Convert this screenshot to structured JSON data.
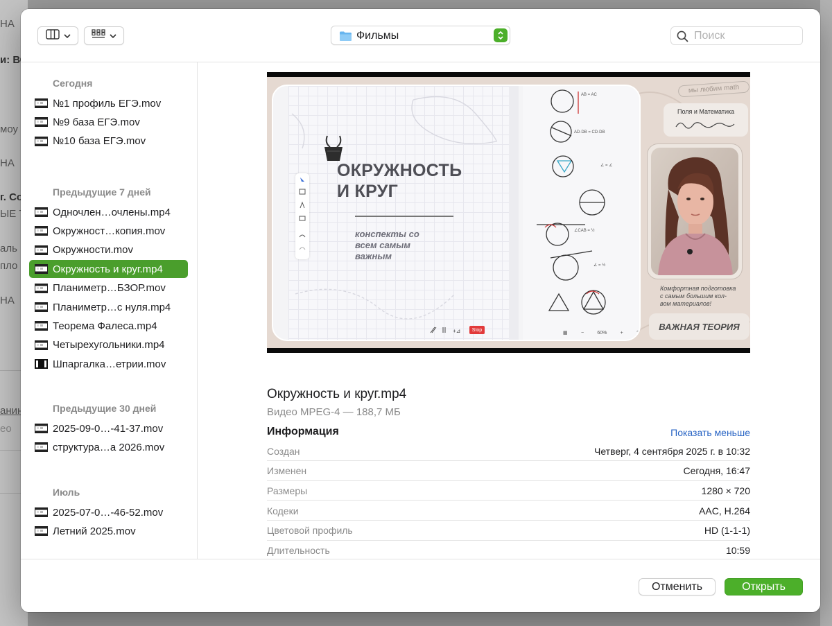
{
  "background_app": {
    "fragments": [
      "НА",
      "и: ВС",
      "моу",
      "НА",
      "г. Со",
      "ЫЕ Т",
      "аль",
      "пло",
      "НА",
      "анин",
      "ео"
    ]
  },
  "toolbar": {
    "location_label": "Фильмы",
    "search_placeholder": "Поиск"
  },
  "sidebar": {
    "sections": [
      {
        "title": "Сегодня",
        "items": [
          "№1 профиль ЕГЭ.mov",
          "№9 база ЕГЭ.mov",
          "№10 база ЕГЭ.mov"
        ]
      },
      {
        "title": "Предыдущие 7 дней",
        "items": [
          "Одночлен…очлены.mp4",
          "Окружност…копия.mov",
          "Окружности.mov",
          "Окружность и круг.mp4",
          "Планиметр…БЗОР.mov",
          "Планиметр…с нуля.mp4",
          "Теорема Фалеса.mp4",
          "Четырехугольники.mp4",
          "Шпаргалка…етрии.mov"
        ]
      },
      {
        "title": "Предыдущие 30 дней",
        "items": [
          "2025-09-0…-41-37.mov",
          "структура…а 2026.mov"
        ]
      },
      {
        "title": "Июль",
        "items": [
          "2025-07-0…-46-52.mov",
          "Летний 2025.mov"
        ]
      }
    ],
    "selected_item": "Окружность и круг.mp4"
  },
  "preview": {
    "thumbnail": {
      "title_line1": "ОКРУЖНОСТЬ",
      "title_line2": "И КРУГ",
      "subtitle_line1": "конспекты со",
      "subtitle_line2": "всем самым",
      "subtitle_line3": "важным",
      "stop_label": "Stop",
      "zoom_level": "60%",
      "promo_tag": "мы любим math",
      "promo_title": "Поля и Математика",
      "promo_desc_line1": "Комфортная подготовка",
      "promo_desc_line2": "с самым большим кол-",
      "promo_desc_line3": "вом материалов!",
      "promo_badge": "ВАЖНАЯ ТЕОРИЯ"
    },
    "file_name": "Окружность и круг.mp4",
    "file_type": "Видео MPEG-4 — 188,7 МБ",
    "info_heading": "Информация",
    "info_toggle": "Показать меньше",
    "info_rows": [
      {
        "label": "Создан",
        "value": "Четверг, 4 сентября 2025 г. в 10:32"
      },
      {
        "label": "Изменен",
        "value": "Сегодня, 16:47"
      },
      {
        "label": "Размеры",
        "value": "1280 × 720"
      },
      {
        "label": "Кодеки",
        "value": "AAC, H.264"
      },
      {
        "label": "Цветовой профиль",
        "value": "HD (1-1-1)"
      },
      {
        "label": "Длительность",
        "value": "10:59"
      }
    ]
  },
  "footer": {
    "cancel_label": "Отменить",
    "open_label": "Открыть"
  },
  "colors": {
    "accent_green": "#4caf2a",
    "selection_green": "#4a9e2c",
    "link_blue": "#2864c4"
  },
  "icons": [
    "sidebar-view-icon",
    "chevron-down-icon",
    "grid-view-icon",
    "folder-icon",
    "stepper-icon",
    "search-icon",
    "video-file-icon"
  ]
}
